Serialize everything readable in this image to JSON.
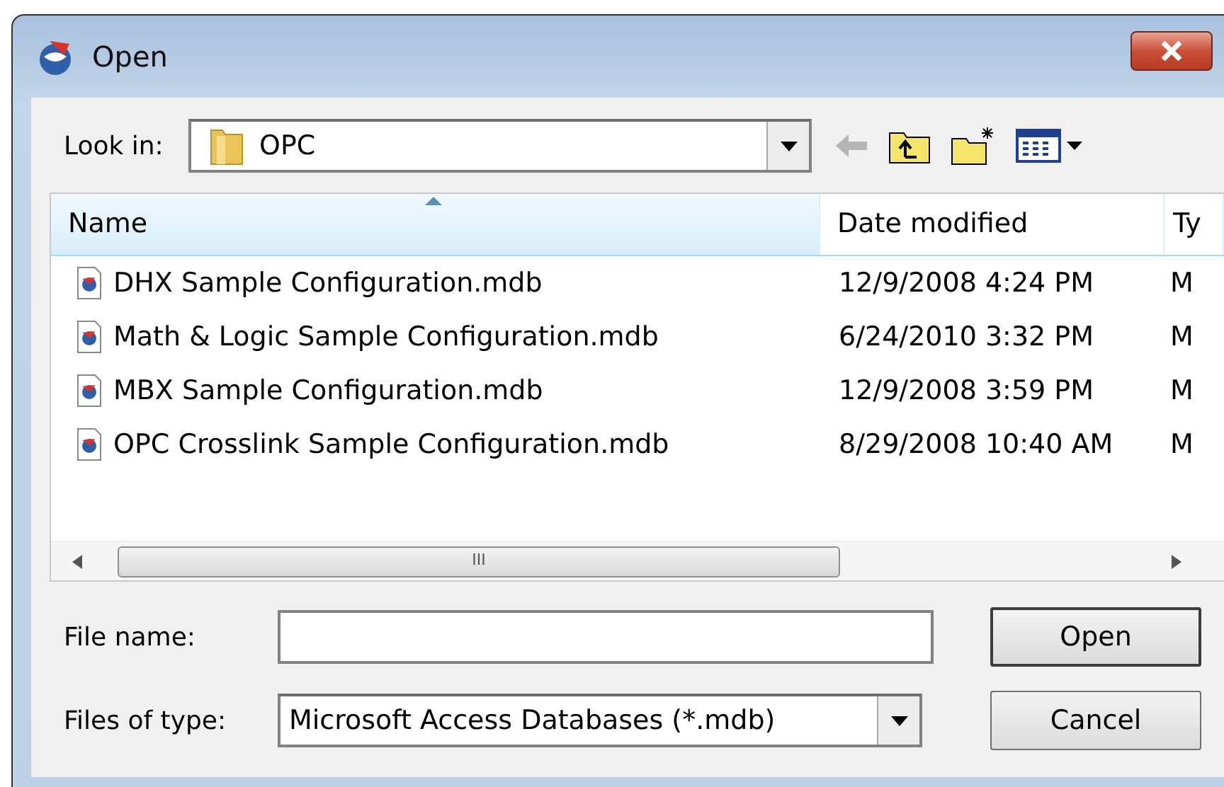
{
  "window": {
    "title": "Open"
  },
  "look_in": {
    "label": "Look in:",
    "value": "OPC"
  },
  "file_list": {
    "columns": [
      {
        "label": "Name",
        "sorted": true
      },
      {
        "label": "Date modified",
        "sorted": false
      },
      {
        "label": "Ty",
        "sorted": false
      }
    ],
    "rows": [
      {
        "name": "DHX Sample Configuration.mdb",
        "date": "12/9/2008 4:24 PM",
        "column_3": "M",
        "selected": false
      },
      {
        "name": "Math & Logic Sample Configuration.mdb",
        "date": "6/24/2010 3:32 PM",
        "column_3": "M",
        "selected": false
      },
      {
        "name": "MBX Sample Configuration.mdb",
        "date": "12/9/2008 3:59 PM",
        "column_3": "M",
        "selected": false
      },
      {
        "name": "OPC Crosslink Sample Configuration.mdb",
        "date": "8/29/2008 10:40 AM",
        "column_3": "M",
        "selected": false
      }
    ],
    "scrollbar_thumb": "III"
  },
  "file_name": {
    "label": "File name:"
  },
  "file_type": {
    "label": "Files of type:",
    "value": "Microsoft Access Databases (*.mdb)"
  },
  "buttons": [
    {
      "label": "Open",
      "default": true
    },
    {
      "label": "Cancel",
      "default": false
    }
  ]
}
